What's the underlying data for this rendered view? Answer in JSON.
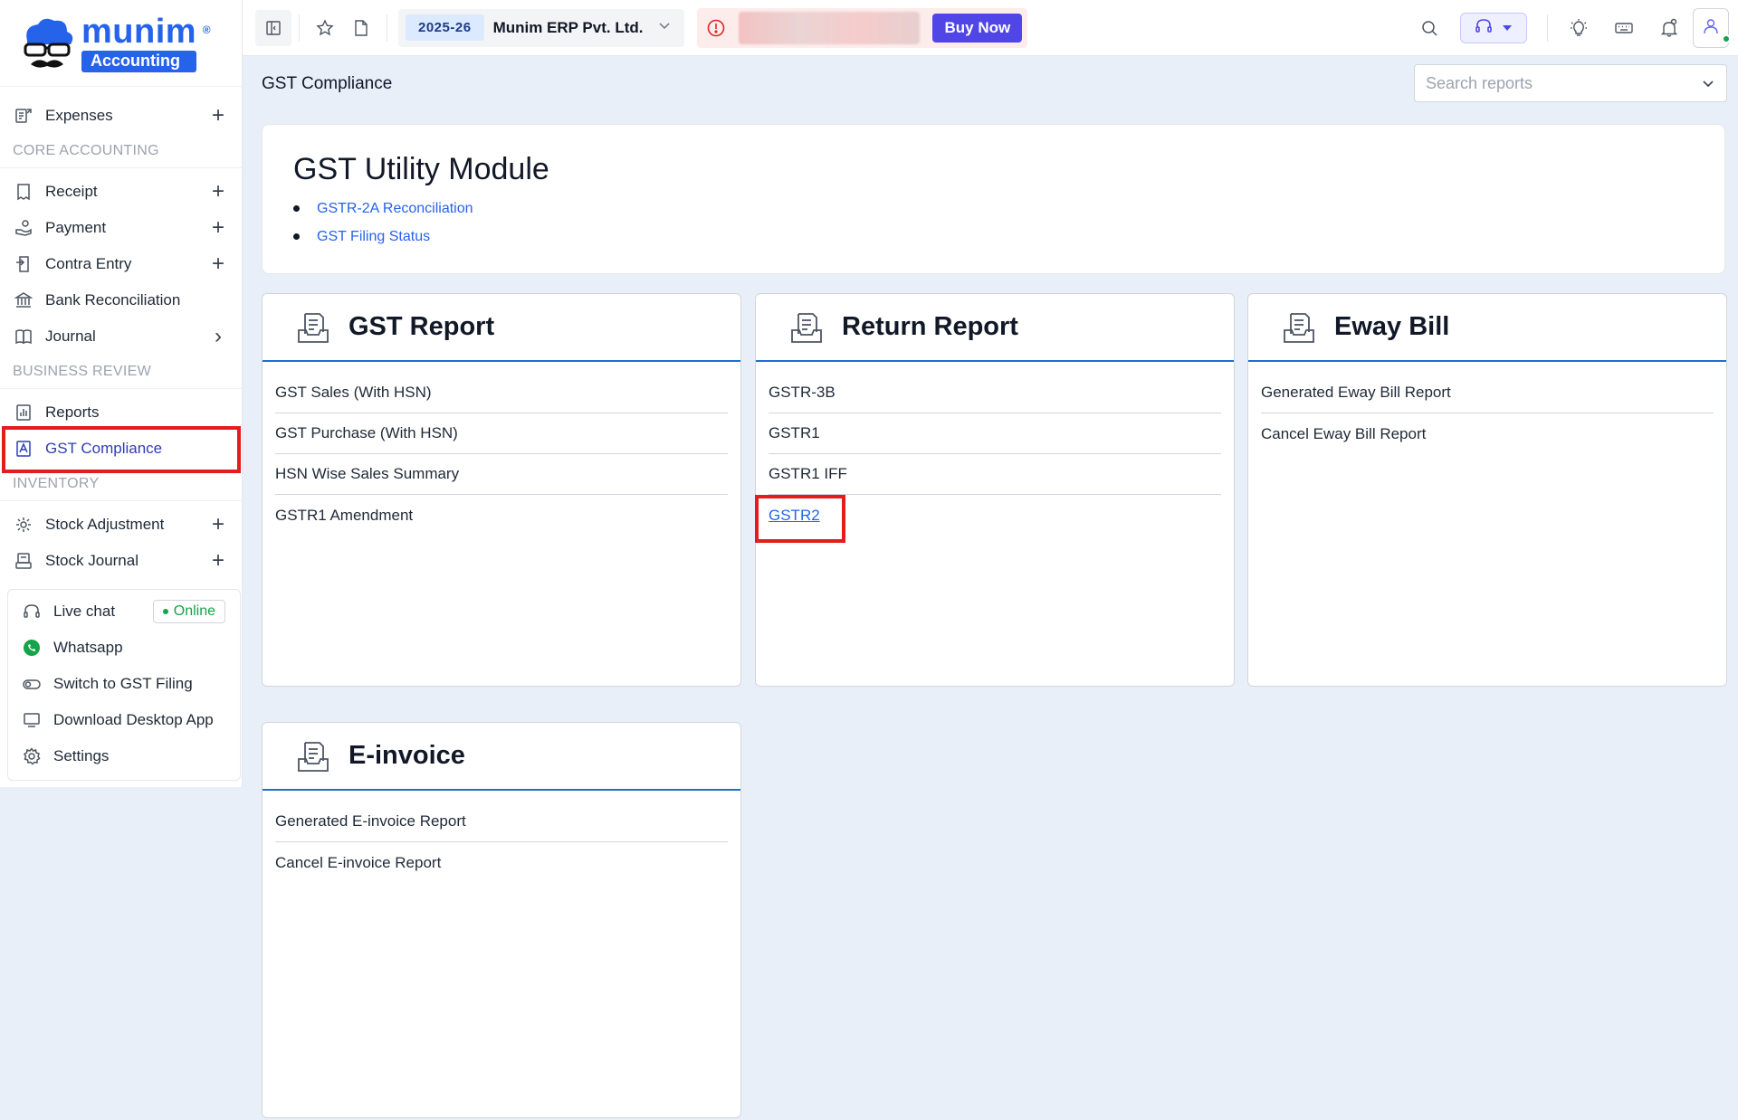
{
  "brand": {
    "name": "munim",
    "sub": "Accounting",
    "reg": "®"
  },
  "sidebar": {
    "items_top": [
      {
        "label": "Expenses",
        "action": "+"
      }
    ],
    "sections": [
      {
        "title": "CORE ACCOUNTING",
        "items": [
          {
            "label": "Receipt",
            "action": "+"
          },
          {
            "label": "Payment",
            "action": "+"
          },
          {
            "label": "Contra Entry",
            "action": "+"
          },
          {
            "label": "Bank Reconciliation",
            "action": ""
          },
          {
            "label": "Journal",
            "action": "›"
          }
        ]
      },
      {
        "title": "BUSINESS REVIEW",
        "items": [
          {
            "label": "Reports",
            "action": ""
          },
          {
            "label": "GST Compliance",
            "action": ""
          }
        ]
      },
      {
        "title": "INVENTORY",
        "items": [
          {
            "label": "Stock Adjustment",
            "action": "+"
          },
          {
            "label": "Stock Journal",
            "action": "+"
          }
        ]
      }
    ],
    "support": {
      "live_chat": "Live chat",
      "online": "Online",
      "whatsapp": "Whatsapp",
      "switch_gst": "Switch to GST Filing",
      "download": "Download Desktop App",
      "settings": "Settings"
    }
  },
  "topbar": {
    "fy": "2025-26",
    "company": "Munim ERP Pvt. Ltd.",
    "buy_now": "Buy Now"
  },
  "page": {
    "title": "GST Compliance",
    "search_placeholder": "Search reports"
  },
  "utility": {
    "title": "GST Utility Module",
    "links": [
      "GSTR-2A Reconciliation",
      "GST Filing Status"
    ]
  },
  "cards": {
    "gst_report": {
      "title": "GST Report",
      "items": [
        "GST Sales (With HSN)",
        "GST Purchase (With HSN)",
        "HSN Wise Sales Summary",
        "GSTR1 Amendment"
      ]
    },
    "return_report": {
      "title": "Return Report",
      "items": [
        "GSTR-3B",
        "GSTR1",
        "GSTR1 IFF",
        "GSTR2"
      ]
    },
    "eway_bill": {
      "title": "Eway Bill",
      "items": [
        "Generated Eway Bill Report",
        "Cancel Eway Bill Report"
      ]
    },
    "einvoice": {
      "title": "E-invoice",
      "items": [
        "Generated E-invoice Report",
        "Cancel E-invoice Report"
      ]
    }
  },
  "colors": {
    "accent": "#2563eb",
    "highlight": "#e11d1d",
    "buy": "#4f46e5",
    "online": "#16a34a"
  }
}
